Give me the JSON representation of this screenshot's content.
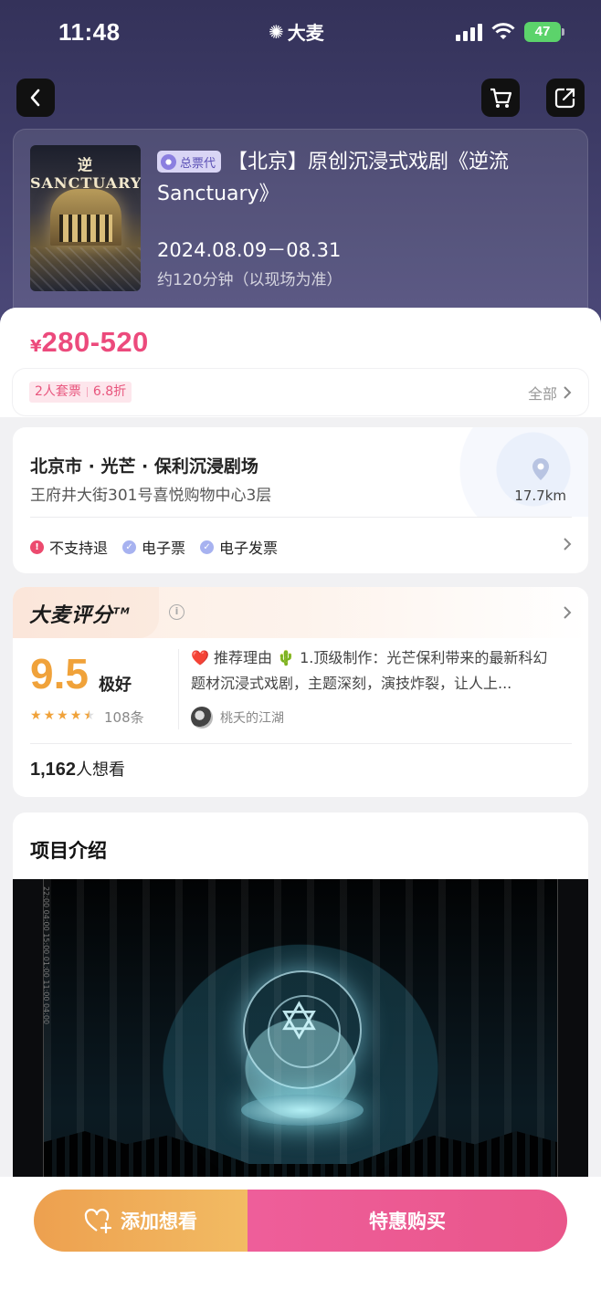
{
  "status_bar": {
    "time": "11:48",
    "brand": "大麦",
    "battery": "47"
  },
  "nav": {
    "back_icon": "chevron-left-icon",
    "cart_icon": "cart-icon",
    "share_icon": "share-icon"
  },
  "event": {
    "poster_title": "逆SANCTUARY流",
    "agency_badge": "总票代",
    "title": "【北京】原创沉浸式戏剧《逆流Sanctuary》",
    "date": "2024.08.09－08.31",
    "duration": "约120分钟（以现场为准）"
  },
  "price": {
    "currency": "¥",
    "range": "280-520",
    "color": "#ec4a7c"
  },
  "promo": {
    "tag_a": "2人套票",
    "tag_b": "6.8折",
    "all_label": "全部"
  },
  "venue": {
    "name": "北京市 · 光芒 · 保利沉浸剧场",
    "address": "王府井大街301号喜悦购物中心3层",
    "distance": "17.7km",
    "services": [
      {
        "label": "不支持退",
        "icon": "!"
      },
      {
        "label": "电子票",
        "icon": "✓"
      },
      {
        "label": "电子发票",
        "icon": "✓"
      }
    ]
  },
  "rating": {
    "brand": "大麦评分",
    "trademark": "TM",
    "score": "9.5",
    "score_word": "极好",
    "stars": 4.5,
    "review_count": "108条",
    "reason": "❤️ 推荐理由 🌵 1.顶级制作：光芒保利带来的最新科幻题材沉浸式戏剧，主题深刻，演技炸裂，让人上...",
    "reviewer": "桃夭的江湖",
    "want_count": "1,162",
    "want_label": "人想看"
  },
  "intro": {
    "title": "项目介绍",
    "film_labels": "22:00 04:00 15:00 01:00 11:00 04:00"
  },
  "actions": {
    "want_label": "添加想看",
    "buy_label": "特惠购买"
  }
}
